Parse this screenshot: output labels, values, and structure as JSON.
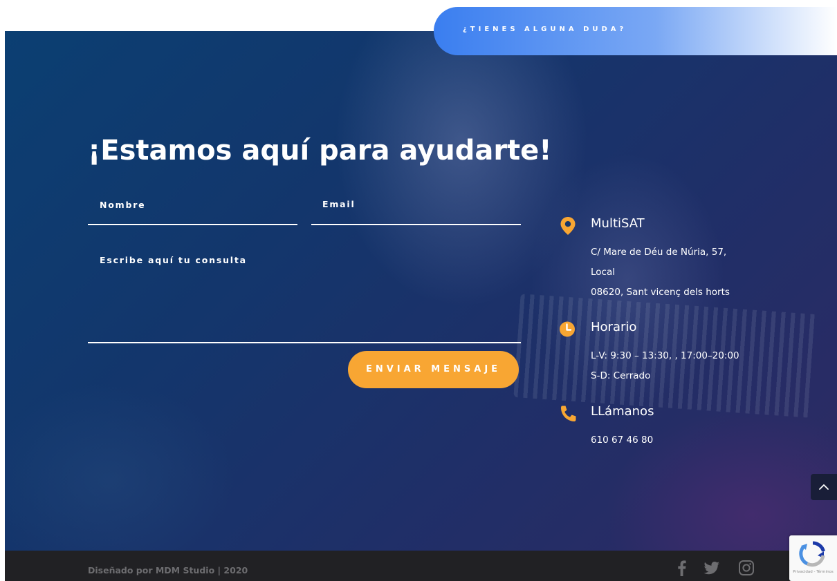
{
  "tab": {
    "label": "¿TIENES ALGUNA DUDA?"
  },
  "contact_form": {
    "heading": "¡Estamos aquí para ayudarte!",
    "name_placeholder": "Nombre",
    "email_placeholder": "Email",
    "message_placeholder": "Escribe aquí tu consulta",
    "submit_label": "ENVIAR MENSAJE"
  },
  "info": {
    "location": {
      "icon": "map-pin-icon",
      "title": "MultiSAT",
      "lines": [
        "C/ Mare de Déu de Núria, 57,",
        "Local",
        "08620, Sant vicenç dels horts"
      ]
    },
    "hours": {
      "icon": "clock-icon",
      "title": "Horario",
      "lines": [
        "L-V: 9:30 – 13:30, , 17:00–20:00",
        "S-D: Cerrado"
      ]
    },
    "call": {
      "icon": "phone-icon",
      "title": "LLámanos",
      "phone": "610 67 46 80"
    }
  },
  "footer": {
    "credit": "Diseñado por MDM Studio | 2020",
    "social": [
      {
        "icon": "facebook-icon"
      },
      {
        "icon": "twitter-icon"
      },
      {
        "icon": "instagram-icon"
      }
    ]
  },
  "recaptcha": {
    "terms": "Privacidad - Términos"
  },
  "colors": {
    "accent_orange": "#f8a633",
    "tab_blue": "#3a7ef0",
    "footer_bg": "#212124"
  }
}
